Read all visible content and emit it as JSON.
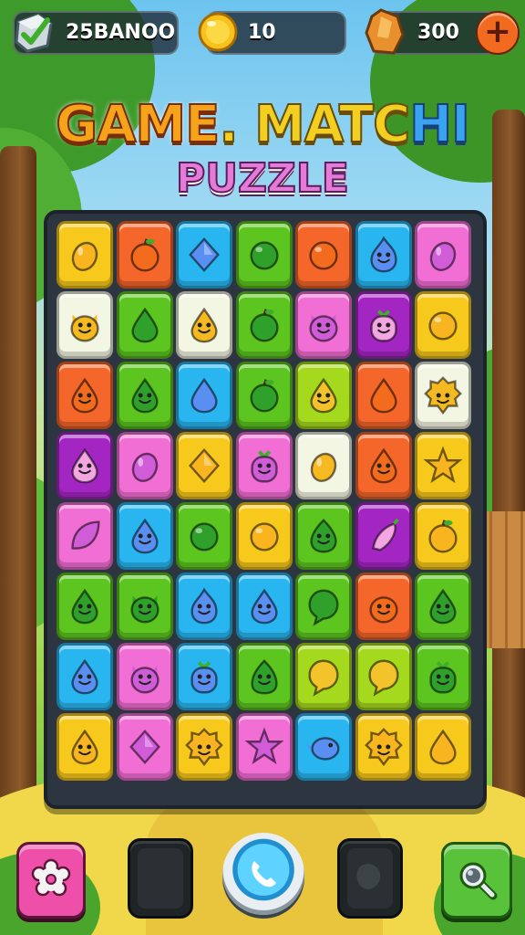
{
  "hud": {
    "gems_value": "25BANOO",
    "coins_value": "10",
    "crystal_value": "300",
    "add_label": "+"
  },
  "title": {
    "line1_part1": "GAME",
    "line1_part2": ".",
    "line1_part3": " MATC",
    "line1_part4": "HI",
    "line2": "PUZZLE"
  },
  "board": {
    "rows": [
      [
        "yellow",
        "orange",
        "blue",
        "green",
        "orange",
        "blue",
        "pink"
      ],
      [
        "white",
        "green",
        "white",
        "green",
        "pink",
        "purple",
        "yellow"
      ],
      [
        "orange",
        "green",
        "blue",
        "green",
        "lime",
        "orange",
        "white"
      ],
      [
        "purple",
        "pink",
        "yellow",
        "pink",
        "white",
        "orange",
        "yellow"
      ],
      [
        "pink",
        "blue",
        "green",
        "yellow",
        "green",
        "purple",
        "yellow"
      ],
      [
        "green",
        "green",
        "blue",
        "blue",
        "green",
        "orange",
        "green"
      ],
      [
        "blue",
        "pink",
        "blue",
        "green",
        "lime",
        "lime",
        "green"
      ],
      [
        "yellow",
        "pink",
        "yellow",
        "pink",
        "blue",
        "yellow",
        "yellow"
      ]
    ],
    "icons": [
      [
        "mango-icon",
        "apple-icon",
        "diamond-icon",
        "green-fruit-icon",
        "lime-icon",
        "flame-face-icon",
        "lemon-icon"
      ],
      [
        "blob-face-icon",
        "drop-icon",
        "smiling-drop-icon",
        "apple-icon",
        "cat-face-icon",
        "radish-face-icon",
        "egg-icon"
      ],
      [
        "smiling-drop-icon",
        "smiling-pear-icon",
        "drop-icon",
        "apple-icon",
        "smiling-drop-icon",
        "drop-icon",
        "lion-face-icon"
      ],
      [
        "smiling-drop-icon",
        "mango-icon",
        "diamond-icon",
        "radish-face-icon",
        "mango-icon",
        "smiling-drop-icon",
        "star-leaf-icon"
      ],
      [
        "leaf-icon",
        "smiling-pear-icon",
        "egg-icon",
        "orange-fruit-icon",
        "onion-face-icon",
        "pepper-icon",
        "apple-icon"
      ],
      [
        "smiling-drop-icon",
        "cat-face-icon",
        "flame-face-icon",
        "smiling-drop-icon",
        "chat-bubble-icon",
        "cat-face-icon",
        "smiling-drop-icon"
      ],
      [
        "smiling-drop-icon",
        "cat-face-icon",
        "radish-face-icon",
        "acorn-face-icon",
        "chat-bubble-icon",
        "chat-bubble-icon",
        "radish-face-icon"
      ],
      [
        "smiling-drop-icon",
        "diamond-icon",
        "lion-face-icon",
        "star-face-icon",
        "bird-icon",
        "lion-face-icon",
        "drop-icon"
      ]
    ]
  },
  "bottom_bar": {
    "left_button_icon": "gear-icon",
    "slot1_icon": "empty-slot-icon",
    "center_button_icon": "phone-icon",
    "slot2_icon": "empty-slot-icon",
    "right_button_icon": "magnifier-icon"
  },
  "colors": {
    "yellow": "#f7c91c",
    "orange": "#f4662a",
    "blue": "#29b6f0",
    "green": "#5cc51f",
    "lime": "#a4d91d",
    "pink": "#f16ed4",
    "purple": "#a326c2",
    "white": "#f4f6e4"
  },
  "icon_colors": {
    "yellow": "#f8b51f",
    "orange": "#f36b1c",
    "blue": "#5a8ff2",
    "green": "#2fa12b",
    "lime": "#f2c32a",
    "pink": "#d05cd8",
    "purple": "#f3a6e2",
    "white": "#f5b922"
  }
}
